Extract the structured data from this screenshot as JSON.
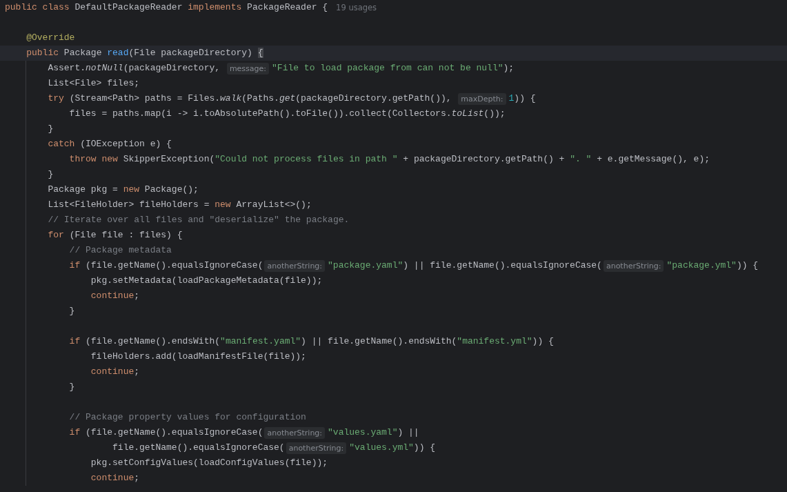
{
  "editor": {
    "lines": [
      {
        "tokens": [
          {
            "kind": "keyword",
            "text": "public class "
          },
          {
            "kind": "plain",
            "text": "DefaultPackageReader "
          },
          {
            "kind": "keyword",
            "text": "implements "
          },
          {
            "kind": "plain",
            "text": "PackageReader {"
          },
          {
            "kind": "usages",
            "text": "19 usages"
          }
        ]
      },
      {
        "blank_before": true,
        "tokens": [
          {
            "kind": "annotation",
            "text": "    @Override"
          }
        ]
      },
      {
        "current": true,
        "tokens": [
          {
            "kind": "keyword",
            "text": "    public "
          },
          {
            "kind": "plain",
            "text": "Package "
          },
          {
            "kind": "declaration",
            "text": "read"
          },
          {
            "kind": "plain",
            "text": "(File packageDirectory) "
          },
          {
            "kind": "brace_match",
            "text": "{"
          }
        ]
      },
      {
        "tokens": [
          {
            "kind": "plain",
            "text": "        Assert."
          },
          {
            "kind": "static",
            "text": "notNull"
          },
          {
            "kind": "plain",
            "text": "(packageDirectory, "
          },
          {
            "kind": "hint",
            "text": "message:"
          },
          {
            "kind": "string",
            "text": "\"File to load package from can not be null\""
          },
          {
            "kind": "plain",
            "text": ");"
          }
        ]
      },
      {
        "tokens": [
          {
            "kind": "plain",
            "text": "        List<File> files;"
          }
        ]
      },
      {
        "tokens": [
          {
            "kind": "keyword",
            "text": "        try "
          },
          {
            "kind": "plain",
            "text": "(Stream<Path> paths = Files."
          },
          {
            "kind": "static",
            "text": "walk"
          },
          {
            "kind": "plain",
            "text": "(Paths."
          },
          {
            "kind": "static",
            "text": "get"
          },
          {
            "kind": "plain",
            "text": "(packageDirectory.getPath()), "
          },
          {
            "kind": "hint",
            "text": "maxDepth:"
          },
          {
            "kind": "number",
            "text": "1"
          },
          {
            "kind": "plain",
            "text": ")) {"
          }
        ]
      },
      {
        "tokens": [
          {
            "kind": "plain",
            "text": "            files = paths.map(i -> i.toAbsolutePath().toFile()).collect(Collectors."
          },
          {
            "kind": "static",
            "text": "toList"
          },
          {
            "kind": "plain",
            "text": "());"
          }
        ]
      },
      {
        "tokens": [
          {
            "kind": "plain",
            "text": "        }"
          }
        ]
      },
      {
        "tokens": [
          {
            "kind": "keyword",
            "text": "        catch "
          },
          {
            "kind": "plain",
            "text": "(IOException e) {"
          }
        ]
      },
      {
        "tokens": [
          {
            "kind": "keyword",
            "text": "            throw new "
          },
          {
            "kind": "plain",
            "text": "SkipperException("
          },
          {
            "kind": "string",
            "text": "\"Could not process files in path \""
          },
          {
            "kind": "plain",
            "text": " + packageDirectory.getPath() + "
          },
          {
            "kind": "string",
            "text": "\". \""
          },
          {
            "kind": "plain",
            "text": " + e.getMessage(), e);"
          }
        ]
      },
      {
        "tokens": [
          {
            "kind": "plain",
            "text": "        }"
          }
        ]
      },
      {
        "tokens": [
          {
            "kind": "plain",
            "text": "        Package pkg = "
          },
          {
            "kind": "keyword",
            "text": "new "
          },
          {
            "kind": "plain",
            "text": "Package();"
          }
        ]
      },
      {
        "tokens": [
          {
            "kind": "plain",
            "text": "        List<FileHolder> fileHolders = "
          },
          {
            "kind": "keyword",
            "text": "new "
          },
          {
            "kind": "plain",
            "text": "ArrayList<>();"
          }
        ]
      },
      {
        "tokens": [
          {
            "kind": "comment",
            "text": "        // Iterate over all files and \"deserialize\" the package."
          }
        ]
      },
      {
        "tokens": [
          {
            "kind": "keyword",
            "text": "        for "
          },
          {
            "kind": "plain",
            "text": "(File file : files) {"
          }
        ]
      },
      {
        "tokens": [
          {
            "kind": "comment",
            "text": "            // Package metadata"
          }
        ]
      },
      {
        "tokens": [
          {
            "kind": "keyword",
            "text": "            if "
          },
          {
            "kind": "plain",
            "text": "(file.getName().equalsIgnoreCase("
          },
          {
            "kind": "hint",
            "text": "anotherString:"
          },
          {
            "kind": "string",
            "text": "\"package.yaml\""
          },
          {
            "kind": "plain",
            "text": ") || file.getName().equalsIgnoreCase("
          },
          {
            "kind": "hint",
            "text": "anotherString:"
          },
          {
            "kind": "string",
            "text": "\"package.yml\""
          },
          {
            "kind": "plain",
            "text": ")) {"
          }
        ]
      },
      {
        "tokens": [
          {
            "kind": "plain",
            "text": "                pkg.setMetadata(loadPackageMetadata(file));"
          }
        ]
      },
      {
        "tokens": [
          {
            "kind": "keyword",
            "text": "                continue"
          },
          {
            "kind": "plain",
            "text": ";"
          }
        ]
      },
      {
        "tokens": [
          {
            "kind": "plain",
            "text": "            }"
          }
        ]
      },
      {
        "blank_before": true,
        "tokens": [
          {
            "kind": "keyword",
            "text": "            if "
          },
          {
            "kind": "plain",
            "text": "(file.getName().endsWith("
          },
          {
            "kind": "string",
            "text": "\"manifest.yaml\""
          },
          {
            "kind": "plain",
            "text": ") || file.getName().endsWith("
          },
          {
            "kind": "string",
            "text": "\"manifest.yml\""
          },
          {
            "kind": "plain",
            "text": ")) {"
          }
        ]
      },
      {
        "tokens": [
          {
            "kind": "plain",
            "text": "                fileHolders.add(loadManifestFile(file));"
          }
        ]
      },
      {
        "tokens": [
          {
            "kind": "keyword",
            "text": "                continue"
          },
          {
            "kind": "plain",
            "text": ";"
          }
        ]
      },
      {
        "tokens": [
          {
            "kind": "plain",
            "text": "            }"
          }
        ]
      },
      {
        "blank_before": true,
        "tokens": [
          {
            "kind": "comment",
            "text": "            // Package property values for configuration"
          }
        ]
      },
      {
        "tokens": [
          {
            "kind": "keyword",
            "text": "            if "
          },
          {
            "kind": "plain",
            "text": "(file.getName().equalsIgnoreCase("
          },
          {
            "kind": "hint",
            "text": "anotherString:"
          },
          {
            "kind": "string",
            "text": "\"values.yaml\""
          },
          {
            "kind": "plain",
            "text": ") ||"
          }
        ]
      },
      {
        "tokens": [
          {
            "kind": "plain",
            "text": "                    file.getName().equalsIgnoreCase("
          },
          {
            "kind": "hint",
            "text": "anotherString:"
          },
          {
            "kind": "string",
            "text": "\"values.yml\""
          },
          {
            "kind": "plain",
            "text": ")) {"
          }
        ]
      },
      {
        "tokens": [
          {
            "kind": "plain",
            "text": "                pkg.setConfigValues(loadConfigValues(file));"
          }
        ]
      },
      {
        "tokens": [
          {
            "kind": "keyword",
            "text": "                continue"
          },
          {
            "kind": "plain",
            "text": ";"
          }
        ]
      }
    ]
  }
}
